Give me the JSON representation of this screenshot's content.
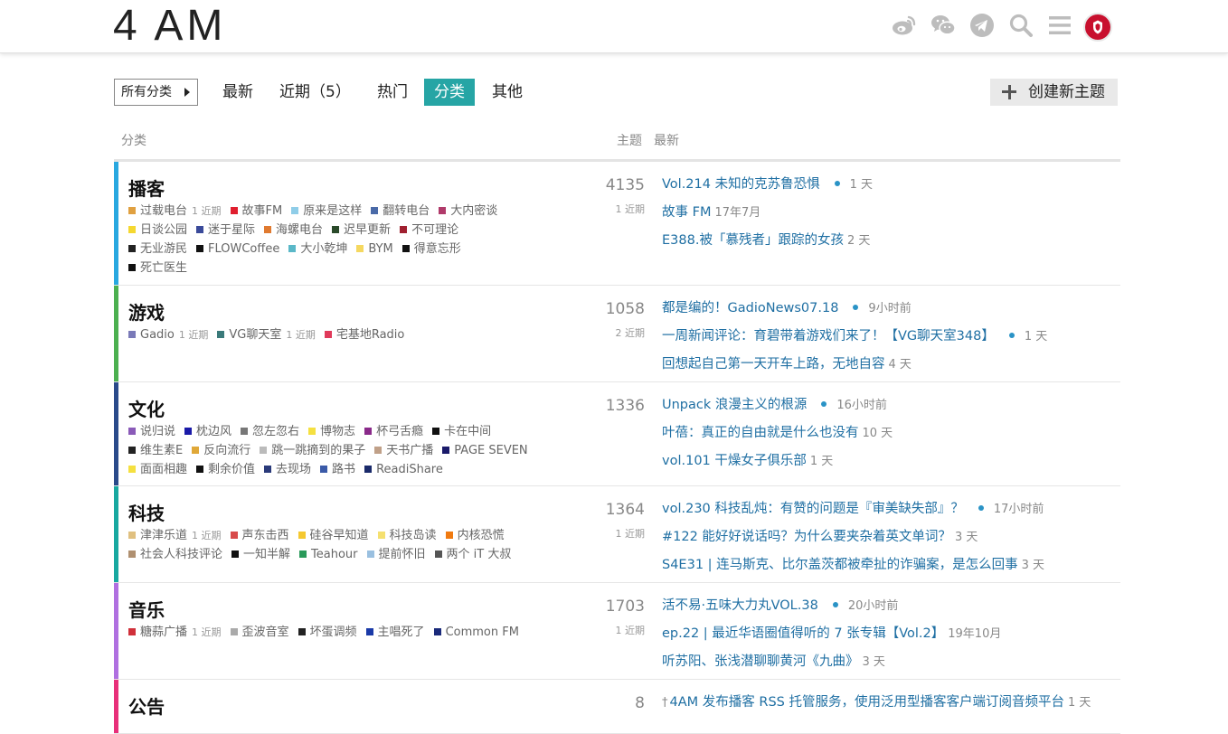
{
  "header": {
    "logo": "4 AM",
    "icons": [
      "weibo-icon",
      "wechat-icon",
      "telegram-icon",
      "search-icon",
      "menu-icon",
      "avatar"
    ]
  },
  "nav": {
    "category_dropdown": "所有分类",
    "items": [
      "最新",
      "近期（5）",
      "热门",
      "分类",
      "其他"
    ],
    "active": "分类",
    "new_topic": "创建新主题"
  },
  "table": {
    "col_category": "分类",
    "col_topics": "主题",
    "col_latest": "最新"
  },
  "categories": [
    {
      "name": "播客",
      "color": "#29a8e0",
      "count": "4135",
      "recent": "1 近期",
      "subs": [
        [
          {
            "name": "过载电台",
            "color": "#e0a040",
            "recent": "1 近期"
          },
          {
            "name": "故事FM",
            "color": "#e01e2e"
          },
          {
            "name": "原来是这样",
            "color": "#8fcde8"
          },
          {
            "name": "翻转电台",
            "color": "#4a6aa8"
          },
          {
            "name": "大内密谈",
            "color": "#b03a6a"
          }
        ],
        [
          {
            "name": "日谈公园",
            "color": "#f5d830"
          },
          {
            "name": "迷于星际",
            "color": "#3a4a9a"
          },
          {
            "name": "海螺电台",
            "color": "#e07a30"
          },
          {
            "name": "迟早更新",
            "color": "#2a4a2a"
          },
          {
            "name": "不可理论",
            "color": "#a02030"
          }
        ],
        [
          {
            "name": "无业游民",
            "color": "#222"
          },
          {
            "name": "FLOWCoffee",
            "color": "#111"
          },
          {
            "name": "大小乾坤",
            "color": "#5ab8c8"
          },
          {
            "name": "BYM",
            "color": "#f5d860"
          },
          {
            "name": "得意忘形",
            "color": "#111"
          }
        ],
        [
          {
            "name": "死亡医生",
            "color": "#111"
          }
        ]
      ],
      "topics": [
        {
          "title": "Vol.214 未知的克苏鲁恐惧",
          "time": "1 天",
          "dot": true
        },
        {
          "title": "故事 FM",
          "time": "17年7月",
          "dot": false
        },
        {
          "title": "E388.被「慕残者」跟踪的女孩",
          "time": "2 天",
          "dot": false
        }
      ]
    },
    {
      "name": "游戏",
      "color": "#4cb050",
      "count": "1058",
      "recent": "2 近期",
      "subs": [
        [
          {
            "name": "Gadio",
            "color": "#7a7ab8",
            "recent": "1 近期"
          },
          {
            "name": "VG聊天室",
            "color": "#3a7a7a",
            "recent": "1 近期"
          },
          {
            "name": "宅基地Radio",
            "color": "#e03a5a"
          }
        ]
      ],
      "topics": [
        {
          "title": "都是编的！GadioNews07.18",
          "time": "9小时前",
          "dot": true
        },
        {
          "title": "一周新闻评论：育碧带着游戏们来了！【VG聊天室348】",
          "time": "1 天",
          "dot": true
        },
        {
          "title": "回想起自己第一天开车上路，无地自容",
          "time": "4 天",
          "dot": false
        }
      ]
    },
    {
      "name": "文化",
      "color": "#2a4a8a",
      "count": "1336",
      "recent": "",
      "subs": [
        [
          {
            "name": "说归说",
            "color": "#8a5ab8"
          },
          {
            "name": "枕边风",
            "color": "#1a1aa8"
          },
          {
            "name": "忽左忽右",
            "color": "#777"
          },
          {
            "name": "博物志",
            "color": "#f5e040"
          },
          {
            "name": "杯弓舌瘾",
            "color": "#8a2a8a"
          },
          {
            "name": "卡在中间",
            "color": "#111"
          }
        ],
        [
          {
            "name": "维生素E",
            "color": "#222"
          },
          {
            "name": "反向流行",
            "color": "#e0a838"
          },
          {
            "name": "跳一跳摘到的果子",
            "color": "#bbb"
          },
          {
            "name": "天书广播",
            "color": "#c0a088"
          },
          {
            "name": "PAGE SEVEN",
            "color": "#1a1a6a"
          }
        ],
        [
          {
            "name": "面面相趣",
            "color": "#f5e040"
          },
          {
            "name": "剩余价值",
            "color": "#111"
          },
          {
            "name": "去现场",
            "color": "#2a3a7a"
          },
          {
            "name": "路书",
            "color": "#3a5aa8"
          },
          {
            "name": "ReadiShare",
            "color": "#1a2a6a"
          }
        ]
      ],
      "topics": [
        {
          "title": "Unpack 浪漫主义的根源",
          "time": "16小时前",
          "dot": true
        },
        {
          "title": "叶蓓：真正的自由就是什么也没有",
          "time": "10 天",
          "dot": false
        },
        {
          "title": "vol.101 干燥女子俱乐部",
          "time": "1 天",
          "dot": false
        }
      ]
    },
    {
      "name": "科技",
      "color": "#18a8a0",
      "count": "1364",
      "recent": "1 近期",
      "subs": [
        [
          {
            "name": "津津乐道",
            "color": "#e0c080",
            "recent": "1 近期"
          },
          {
            "name": "声东击西",
            "color": "#d84a4a"
          },
          {
            "name": "硅谷早知道",
            "color": "#f5c830"
          },
          {
            "name": "科技岛读",
            "color": "#f5e070"
          },
          {
            "name": "内核恐慌",
            "color": "#f07a10"
          }
        ],
        [
          {
            "name": "社会人科技评论",
            "color": "#b09070"
          },
          {
            "name": "一知半解",
            "color": "#111"
          },
          {
            "name": "Teahour",
            "color": "#2a9a5a"
          },
          {
            "name": "提前怀旧",
            "color": "#9ac0e0"
          },
          {
            "name": "两个 iT 大叔",
            "color": "#555"
          }
        ]
      ],
      "topics": [
        {
          "title": "vol.230 科技乱炖：有赞的问题是『审美缺失部』？",
          "time": "17小时前",
          "dot": true
        },
        {
          "title": "#122 能好好说话吗？为什么要夹杂着英文单词？",
          "time": "3 天",
          "dot": false
        },
        {
          "title": "S4E31 | 连马斯克、比尔盖茨都被牵扯的诈骗案，是怎么回事",
          "time": "3 天",
          "dot": false
        }
      ]
    },
    {
      "name": "音乐",
      "color": "#b070e0",
      "count": "1703",
      "recent": "1 近期",
      "subs": [
        [
          {
            "name": "糖蒜广播",
            "color": "#d0303a",
            "recent": "1 近期"
          },
          {
            "name": "歪波音室",
            "color": "#aaa"
          },
          {
            "name": "坏蛋调频",
            "color": "#222"
          },
          {
            "name": "主唱死了",
            "color": "#1a3aa8"
          },
          {
            "name": "Common FM",
            "color": "#1a2a7a"
          }
        ]
      ],
      "topics": [
        {
          "title": "活不易·五味大力丸VOL.38",
          "time": "20小时前",
          "dot": true
        },
        {
          "title": "ep.22 | 最近华语圈值得听的 7 张专辑【Vol.2】",
          "time": "19年10月",
          "dot": false
        },
        {
          "title": "听苏阳、张浅潜聊聊黄河《九曲》",
          "time": "3 天",
          "dot": false
        }
      ]
    },
    {
      "name": "公告",
      "color": "#e8307a",
      "count": "8",
      "recent": "",
      "subs": [],
      "topics": [
        {
          "title": "4AM 发布播客 RSS 托管服务，使用泛用型播客客户端订阅音频平台",
          "time": "1 天",
          "dot": false,
          "pinned": true
        }
      ]
    }
  ]
}
